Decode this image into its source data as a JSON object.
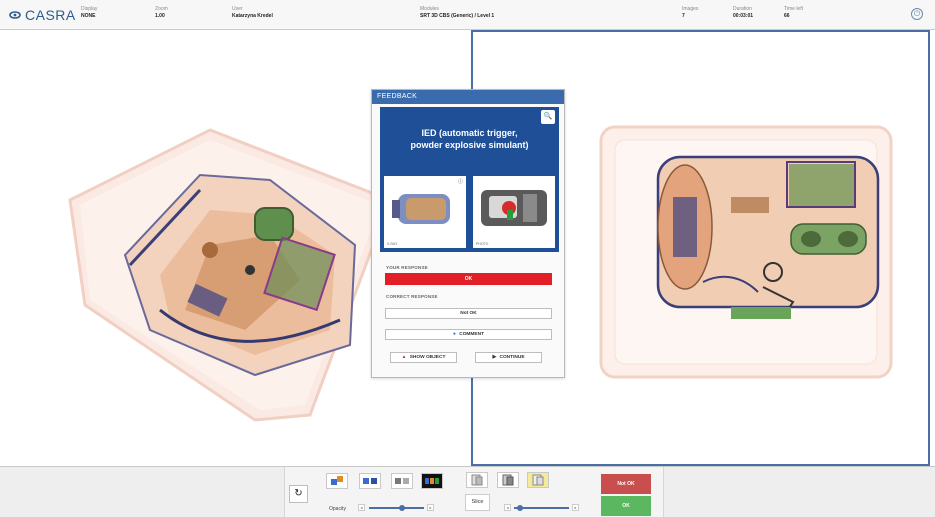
{
  "app": {
    "name": "CASRA"
  },
  "header": {
    "display": {
      "label": "Display",
      "value": "NONE"
    },
    "zoom": {
      "label": "Zoom",
      "value": "1.00"
    },
    "user": {
      "label": "User",
      "value": "Katarzyna Kredel"
    },
    "modules": {
      "label": "Modules",
      "value": "SRT 3D CBS (Generic) / Level 1"
    },
    "images": {
      "label": "Images",
      "value": "7"
    },
    "duration": {
      "label": "Duration",
      "value": "00:03:01"
    },
    "time_left": {
      "label": "Time left",
      "value": "66"
    }
  },
  "feedback": {
    "header": "FEEDBACK",
    "title_line1": "IED (automatic trigger,",
    "title_line2": "powder explosive simulant)",
    "thumb_left_caption": "X-RAY",
    "thumb_right_caption": "PHOTO",
    "your_response_label": "YOUR RESPONSE",
    "your_response_value": "OK",
    "correct_label": "CORRECT RESPONSE",
    "correct_value": "Not OK",
    "comment_label": "COMMENT",
    "show_object_label": "SHOW OBJECT",
    "continue_label": "CONTINUE"
  },
  "toolbar": {
    "reset_icon": "reset-icon",
    "opacity_label": "Opacity",
    "slice_label": "Slice",
    "not_ok_label": "Not OK",
    "ok_label": "OK",
    "opacity_level": 0.6,
    "slice_level": 0.1
  },
  "colors": {
    "accent": "#3a6bad",
    "card": "#1f4f96",
    "response": "#e21e26",
    "not_ok": "#c94e4e",
    "ok": "#5cb860"
  }
}
